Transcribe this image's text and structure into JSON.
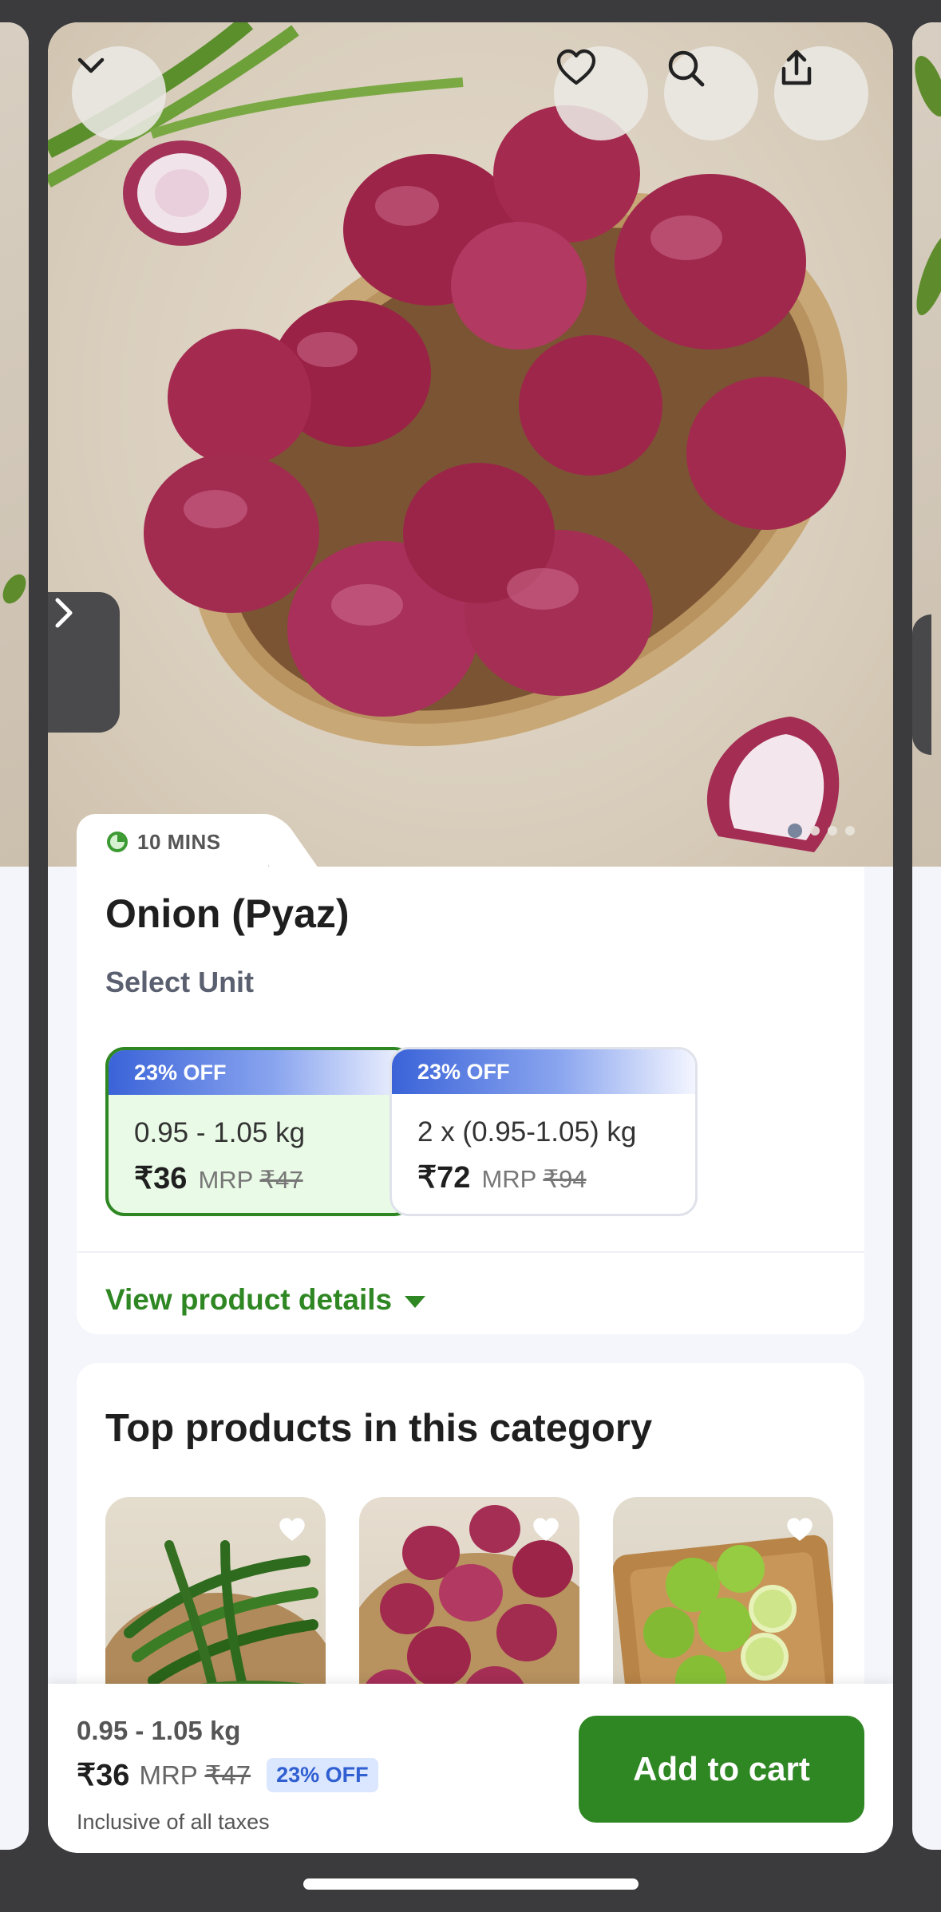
{
  "top_bar": {
    "collapse_icon": "chevron-down-icon",
    "wishlist_icon": "heart-icon",
    "search_icon": "search-icon",
    "share_icon": "share-icon"
  },
  "gallery": {
    "prev_icon": "chevron-right-icon",
    "images_total": 4,
    "active_image": 1
  },
  "delivery": {
    "eta": "10 MINS"
  },
  "product": {
    "title": "Onion (Pyaz)",
    "select_unit_label": "Select Unit",
    "units": [
      {
        "discount": "23% OFF",
        "quantity": "0.95  - 1.05 kg",
        "price": "₹36",
        "mrp_label": "MRP",
        "mrp": "₹47",
        "selected": true
      },
      {
        "discount": "23% OFF",
        "quantity": "2 x (0.95-1.05) kg",
        "price": "₹72",
        "mrp_label": "MRP",
        "mrp": "₹94",
        "selected": false
      }
    ],
    "view_details": "View product details"
  },
  "top_products": {
    "title": "Top products in this category",
    "items": [
      {
        "name": "green-chilli"
      },
      {
        "name": "onion"
      },
      {
        "name": "lemon"
      }
    ]
  },
  "cart_bar": {
    "quantity": "0.95  - 1.05 kg",
    "price": "₹36",
    "mrp_label": "MRP",
    "mrp": "₹47",
    "discount": "23% OFF",
    "tax_note": "Inclusive of all taxes",
    "add_button": "Add to cart"
  },
  "colors": {
    "brand_green": "#2e8722",
    "discount_blue": "#3a63d8",
    "selected_bg": "#e9fbe6"
  }
}
